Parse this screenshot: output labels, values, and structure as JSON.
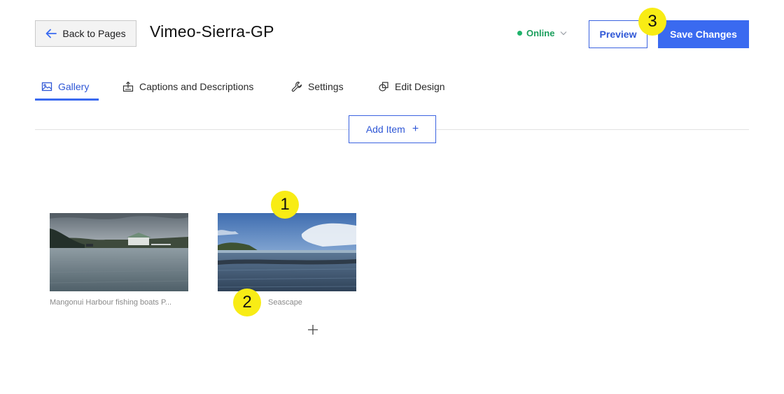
{
  "header": {
    "back_label": "Back to Pages",
    "title": "Vimeo-Sierra-GP",
    "status_label": "Online",
    "preview_label": "Preview",
    "save_label": "Save Changes"
  },
  "tabs": [
    {
      "label": "Gallery",
      "icon": "image-icon",
      "active": true
    },
    {
      "label": "Captions and Descriptions",
      "icon": "captions-icon",
      "active": false
    },
    {
      "label": "Settings",
      "icon": "wrench-icon",
      "active": false
    },
    {
      "label": "Edit Design",
      "icon": "design-icon",
      "active": false
    }
  ],
  "add_item_label": "Add Item",
  "gallery": [
    {
      "caption": "Mangonui Harbour fishing boats P..."
    },
    {
      "caption": "Seascape"
    }
  ],
  "markers": [
    "1",
    "2",
    "3"
  ],
  "colors": {
    "accent": "#3a6af0",
    "status_green": "#1fb36b",
    "marker_yellow": "#f8ec15"
  }
}
